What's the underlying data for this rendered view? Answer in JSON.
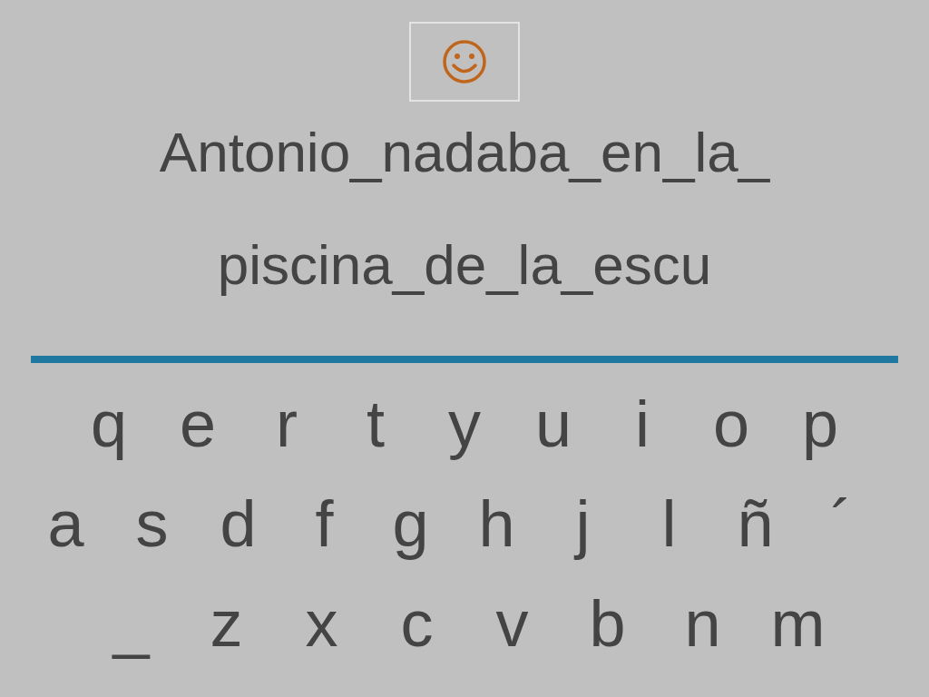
{
  "sentence_lines": [
    "Antonio_nadaba_en_la_",
    "piscina_de_la_escu"
  ],
  "keyboard": [
    [
      "q",
      "e",
      "r",
      "t",
      "y",
      "u",
      "i",
      "o",
      "p"
    ],
    [
      "a",
      "s",
      "d",
      "f",
      "g",
      "h",
      "j",
      "l",
      "ñ",
      "´"
    ],
    [
      "_",
      "z",
      "x",
      "c",
      "v",
      "b",
      "n",
      "m"
    ]
  ]
}
